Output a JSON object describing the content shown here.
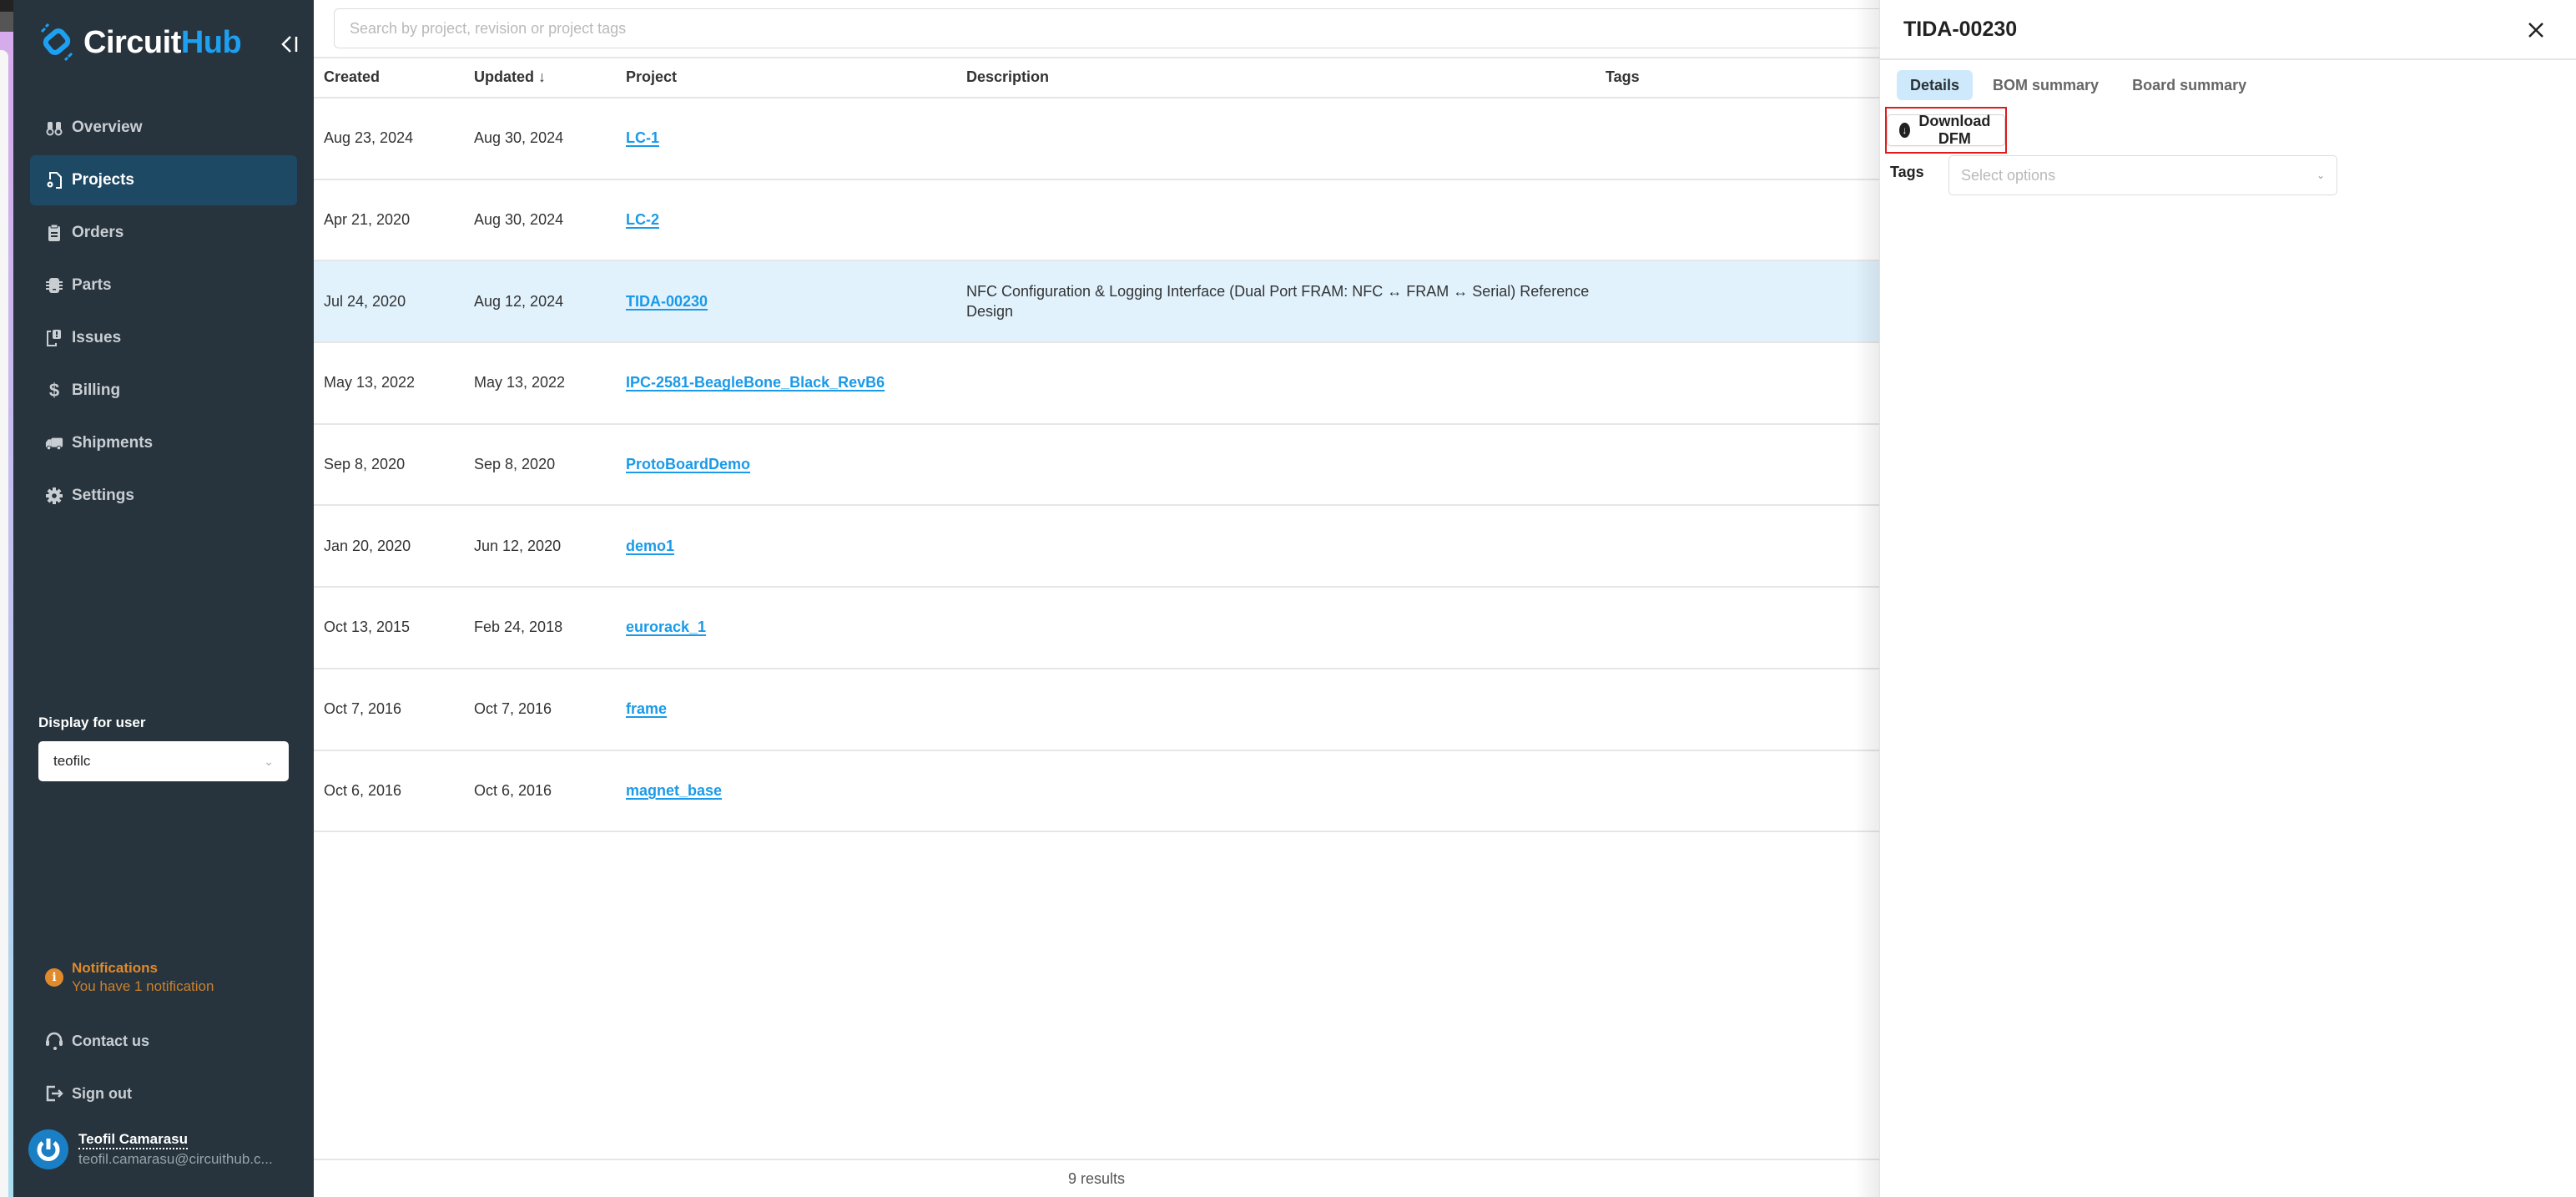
{
  "app": {
    "brand_primary": "Circuit",
    "brand_secondary": "Hub",
    "accent_color": "#1ea0f2"
  },
  "sidebar": {
    "collapse_label": "collapse-sidebar",
    "items": [
      {
        "label": "Overview",
        "icon": "binoculars-icon",
        "active": false
      },
      {
        "label": "Projects",
        "icon": "file-gear-icon",
        "active": true
      },
      {
        "label": "Orders",
        "icon": "clipboard-icon",
        "active": false
      },
      {
        "label": "Parts",
        "icon": "chip-icon",
        "active": false
      },
      {
        "label": "Issues",
        "icon": "issue-icon",
        "active": false
      },
      {
        "label": "Billing",
        "icon": "dollar-icon",
        "active": false
      },
      {
        "label": "Shipments",
        "icon": "truck-icon",
        "active": false
      },
      {
        "label": "Settings",
        "icon": "gear-icon",
        "active": false
      }
    ],
    "display_for_user": {
      "label": "Display for user",
      "value": "teofilc"
    },
    "notifications": {
      "title": "Notifications",
      "text": "You have 1 notification"
    },
    "contact": "Contact us",
    "signout": "Sign out",
    "account": {
      "name": "Teofil Camarasu",
      "email": "teofil.camarasu@circuithub.c..."
    }
  },
  "main": {
    "search": {
      "placeholder": "Search by project, revision or project tags",
      "value": ""
    },
    "columns": {
      "created": "Created",
      "updated": "Updated ↓",
      "project": "Project",
      "description": "Description",
      "tags": "Tags"
    },
    "rows": [
      {
        "created": "Aug 23, 2024",
        "updated": "Aug 30, 2024",
        "project": "LC-1",
        "description": "",
        "tags": ""
      },
      {
        "created": "Apr 21, 2020",
        "updated": "Aug 30, 2024",
        "project": "LC-2",
        "description": "",
        "tags": ""
      },
      {
        "created": "Jul 24, 2020",
        "updated": "Aug 12, 2024",
        "project": "TIDA-00230",
        "description": "NFC Configuration & Logging Interface (Dual Port FRAM: NFC ↔ FRAM ↔ Serial) Reference Design",
        "tags": "",
        "selected": true
      },
      {
        "created": "May 13, 2022",
        "updated": "May 13, 2022",
        "project": "IPC-2581-BeagleBone_Black_RevB6",
        "description": "",
        "tags": ""
      },
      {
        "created": "Sep 8, 2020",
        "updated": "Sep 8, 2020",
        "project": "ProtoBoardDemo",
        "description": "",
        "tags": ""
      },
      {
        "created": "Jan 20, 2020",
        "updated": "Jun 12, 2020",
        "project": "demo1",
        "description": "",
        "tags": ""
      },
      {
        "created": "Oct 13, 2015",
        "updated": "Feb 24, 2018",
        "project": "eurorack_1",
        "description": "",
        "tags": ""
      },
      {
        "created": "Oct 7, 2016",
        "updated": "Oct 7, 2016",
        "project": "frame",
        "description": "",
        "tags": ""
      },
      {
        "created": "Oct 6, 2016",
        "updated": "Oct 6, 2016",
        "project": "magnet_base",
        "description": "",
        "tags": ""
      }
    ],
    "results": "9 results"
  },
  "panel": {
    "title": "TIDA-00230",
    "tabs": [
      {
        "label": "Details",
        "active": true
      },
      {
        "label": "BOM summary",
        "active": false
      },
      {
        "label": "Board summary",
        "active": false
      }
    ],
    "download_label": "Download DFM",
    "tags_label": "Tags",
    "tags_placeholder": "Select options",
    "highlight_color": "#e01b1b"
  }
}
